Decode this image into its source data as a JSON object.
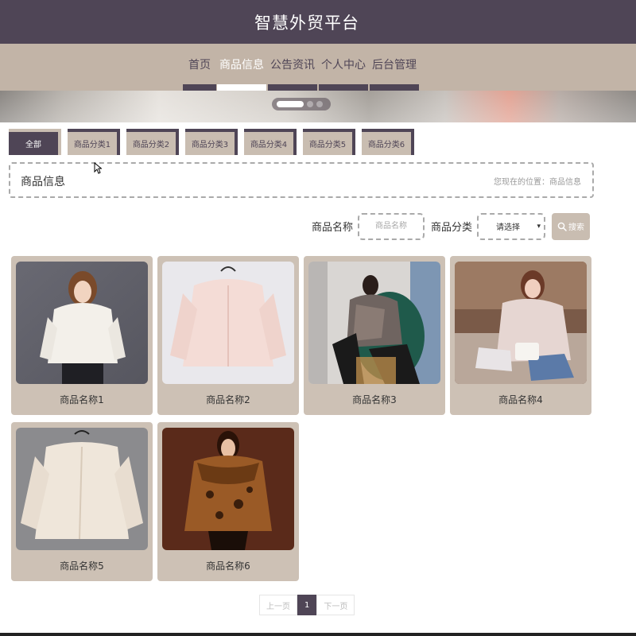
{
  "site": {
    "title": "智慧外贸平台"
  },
  "nav": {
    "items": [
      {
        "label": "首页",
        "active": false
      },
      {
        "label": "商品信息",
        "active": true
      },
      {
        "label": "公告资讯",
        "active": false
      },
      {
        "label": "个人中心",
        "active": false
      },
      {
        "label": "后台管理",
        "active": false
      }
    ]
  },
  "banner": {
    "slide_count": 3,
    "current_slide": 1
  },
  "categories": [
    {
      "label": "全部",
      "active": true
    },
    {
      "label": "商品分类1",
      "active": false
    },
    {
      "label": "商品分类2",
      "active": false
    },
    {
      "label": "商品分类3",
      "active": false
    },
    {
      "label": "商品分类4",
      "active": false
    },
    {
      "label": "商品分类5",
      "active": false
    },
    {
      "label": "商品分类6",
      "active": false
    }
  ],
  "breadcrumb": {
    "title": "商品信息",
    "location": "您现在的位置：商品信息"
  },
  "search": {
    "name_label": "商品名称",
    "name_placeholder": "商品名称",
    "name_value": "",
    "category_label": "商品分类",
    "category_value": "请选择",
    "button_label": "搜索"
  },
  "products": [
    {
      "name": "商品名称1"
    },
    {
      "name": "商品名称2"
    },
    {
      "name": "商品名称3"
    },
    {
      "name": "商品名称4"
    },
    {
      "name": "商品名称5"
    },
    {
      "name": "商品名称6"
    }
  ],
  "pagination": {
    "prev_label": "上一页",
    "current_page": "1",
    "next_label": "下一页"
  },
  "colors": {
    "primary": "#4f4556",
    "secondary": "#c2b4a7",
    "card": "#cdc1b5"
  }
}
